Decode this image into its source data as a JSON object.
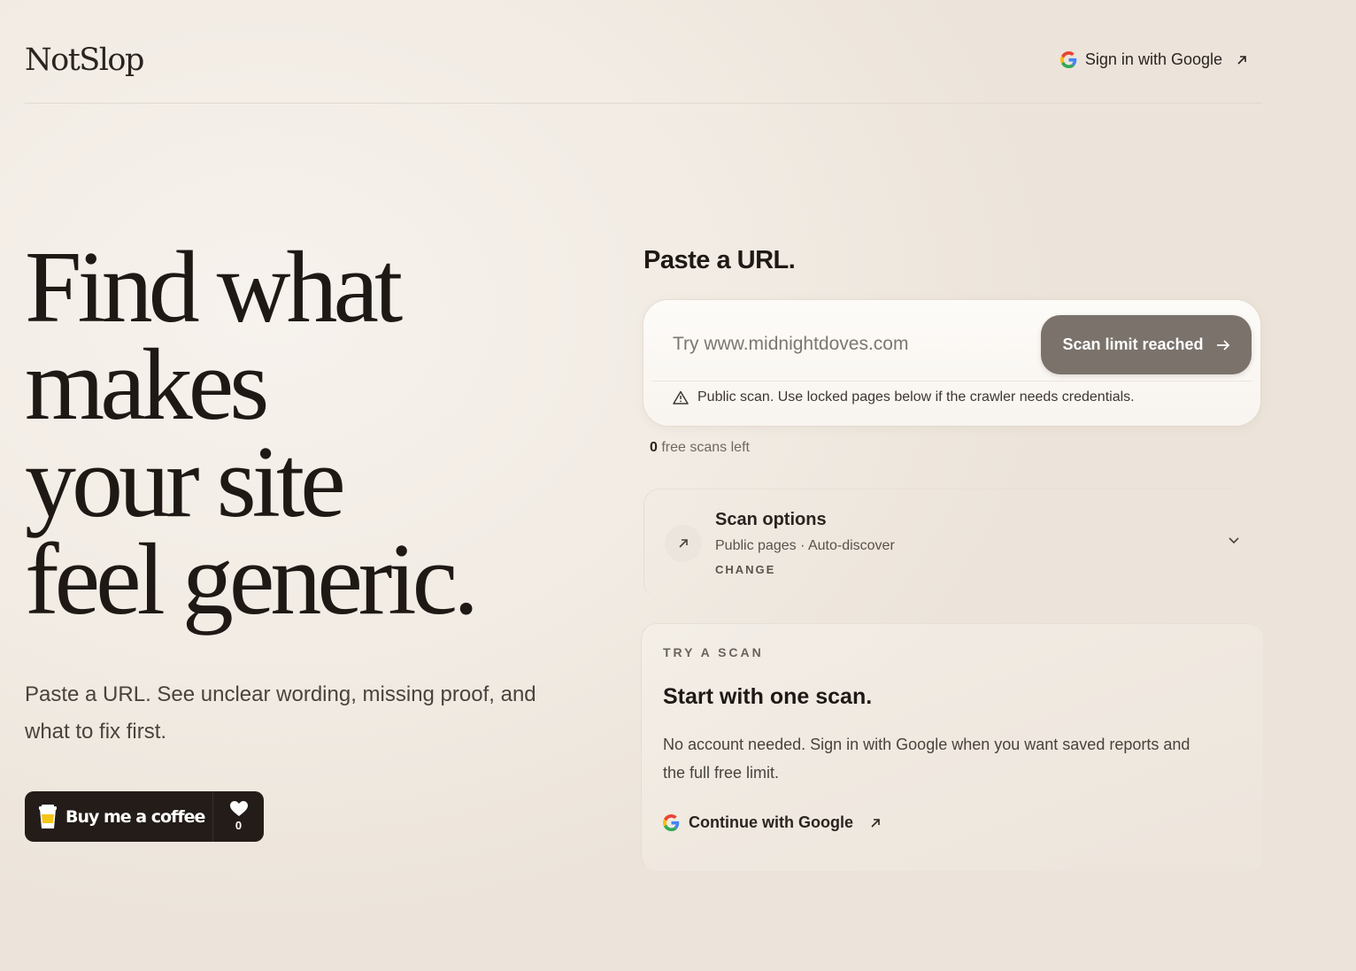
{
  "header": {
    "logo": "NotSlop",
    "signin_label": "Sign in with Google"
  },
  "hero": {
    "title_lines": [
      "Find what",
      "makes",
      "your site",
      "feel generic."
    ],
    "subtitle": "Paste a URL. See unclear wording, missing proof, and what to fix first.",
    "bmc_label": "Buy me a coffee",
    "bmc_count": "0"
  },
  "scan": {
    "title": "Paste a URL.",
    "placeholder": "Try www.midnightdoves.com",
    "button_label": "Scan limit reached",
    "notice": "Public scan. Use locked pages below if the crawler needs credentials.",
    "free_count": "0",
    "free_label": "free scans left"
  },
  "options": {
    "title": "Scan options",
    "subtitle": "Public pages · Auto-discover",
    "change_label": "CHANGE"
  },
  "try": {
    "kicker": "TRY A SCAN",
    "title": "Start with one scan.",
    "body": "No account needed. Sign in with Google when you want saved reports and the full free limit.",
    "google_label": "Continue with Google"
  },
  "colors": {
    "background": "#f1ebe3",
    "ink": "#2a2320",
    "button_disabled": "#7a726b",
    "bmc_bg": "#231c18"
  },
  "icons": {
    "google": "google-icon",
    "external": "arrow-up-right-icon",
    "arrow": "arrow-right-icon",
    "warning": "warning-triangle-icon",
    "chevron": "chevron-down-icon",
    "cup": "coffee-cup-icon",
    "heart": "heart-icon"
  }
}
